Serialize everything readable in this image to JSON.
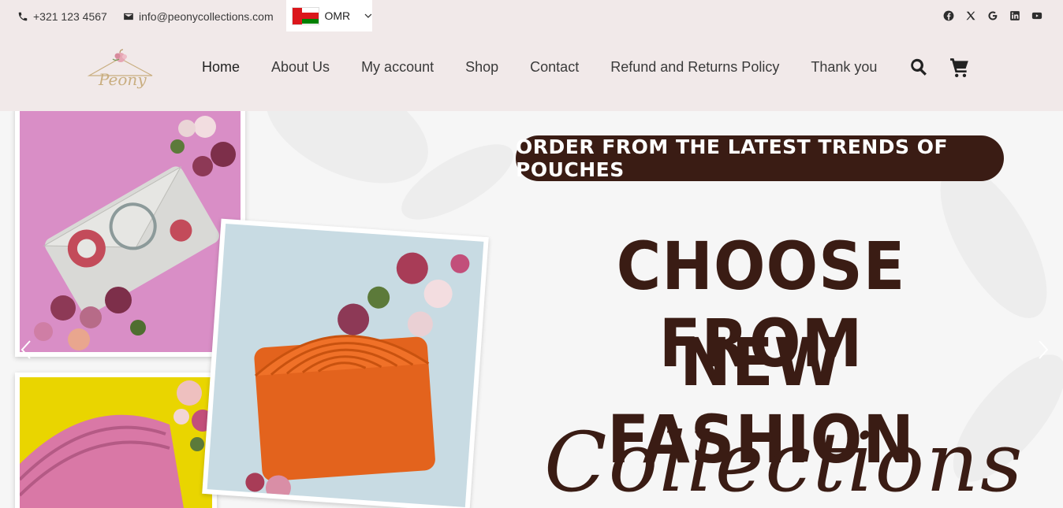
{
  "topbar": {
    "phone": "+321 123 4567",
    "email": "info@peonycollections.com",
    "currency": "OMR",
    "socials": [
      "facebook-icon",
      "x-icon",
      "google-icon",
      "linkedin-icon",
      "youtube-icon"
    ]
  },
  "nav": {
    "items": [
      "Home",
      "About Us",
      "My account",
      "Shop",
      "Contact",
      "Refund and Returns Policy",
      "Thank you"
    ]
  },
  "hero": {
    "pill": "ORDER  FROM THE LATEST TRENDS OF POUCHES",
    "line1": "CHOOSE FROM",
    "line2": "NEW FASHION",
    "line3": "Collections"
  },
  "colors": {
    "header_bg": "#f1e9e9",
    "brand_dark": "#3a1c14",
    "hero_bg": "#f6f6f6"
  }
}
